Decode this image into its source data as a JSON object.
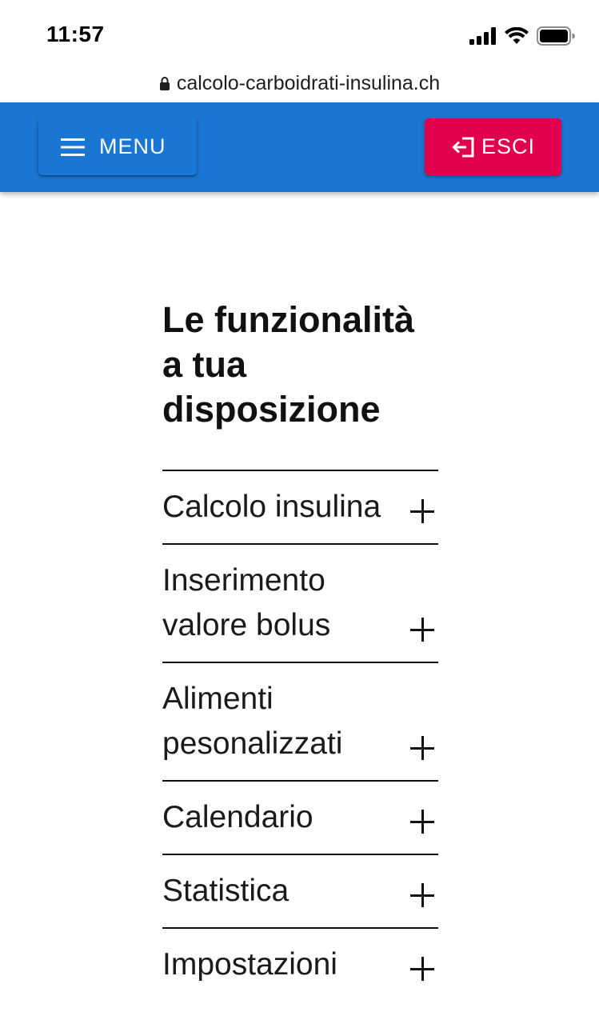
{
  "status_bar": {
    "time": "11:57",
    "icons": [
      "cellular-signal-icon",
      "wifi-icon",
      "battery-icon"
    ]
  },
  "browser": {
    "url": "calcolo-carboidrati-insulina.ch",
    "lock_icon": "lock-icon"
  },
  "header": {
    "menu_label": "MENU",
    "menu_icon": "hamburger-menu-icon",
    "exit_label": "ESCI",
    "exit_icon": "logout-icon",
    "colors": {
      "app_bar": "#1976d2",
      "exit_button": "#e0004d"
    }
  },
  "main": {
    "title": "Le funzionalità a tua disposizione",
    "features": [
      {
        "label": "Calcolo insulina"
      },
      {
        "label": "Inserimento valore bolus"
      },
      {
        "label": "Alimenti pesonalizzati"
      },
      {
        "label": "Calendario"
      },
      {
        "label": "Statistica"
      },
      {
        "label": "Impostazioni"
      }
    ],
    "expand_icon": "plus-icon"
  }
}
